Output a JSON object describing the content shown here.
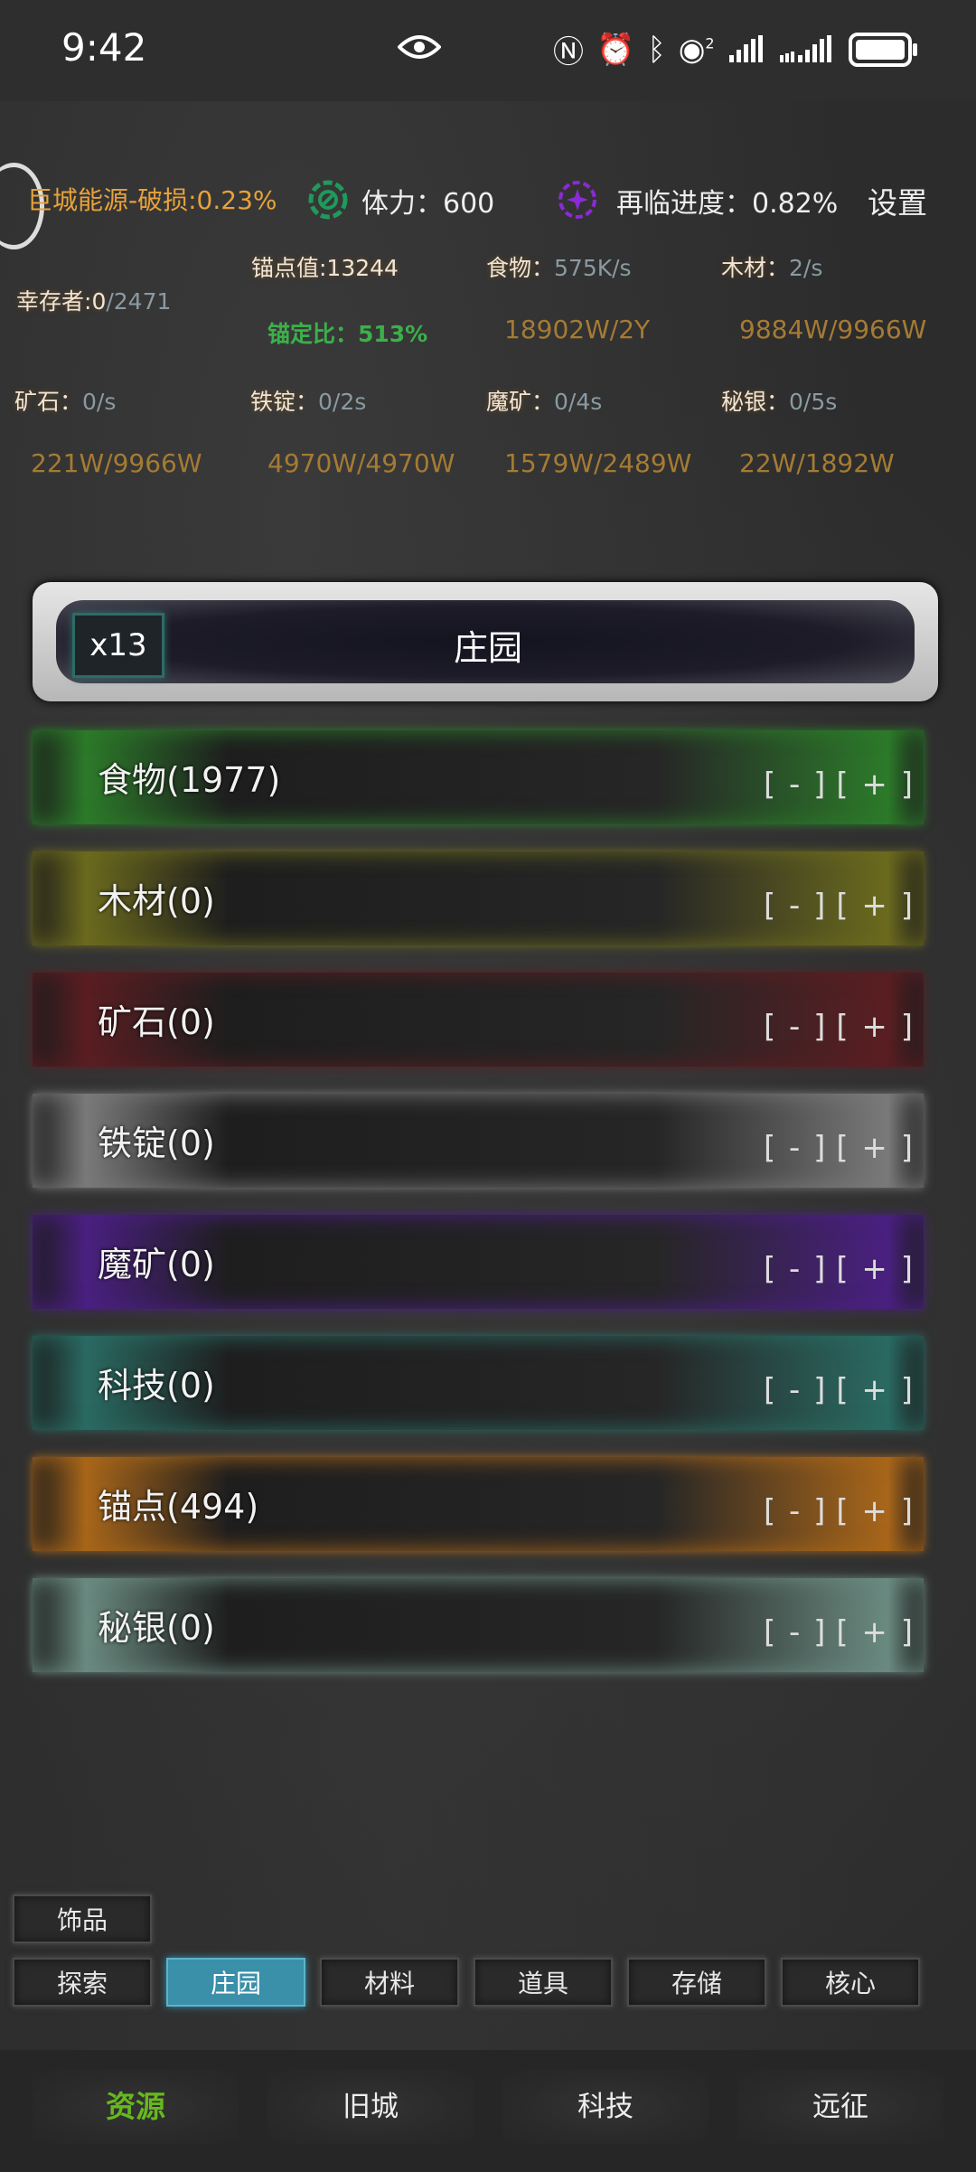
{
  "status_bar": {
    "time": "9:42",
    "icons": [
      "eye-icon",
      "nfc-icon",
      "alarm-icon",
      "bluetooth-icon",
      "hotspot-icon",
      "signal-icon",
      "signal-icon",
      "battery-icon"
    ],
    "hotspot_superscript": "2"
  },
  "header": {
    "energy": "巨城能源-破损:0.23%",
    "stamina": "体力：600",
    "recurrence": "再临进度：0.82%",
    "settings": "设置"
  },
  "stats": {
    "survivors_label": "幸存者:",
    "survivors_current": "0",
    "survivors_total": "/2471",
    "anchor_value": "锚点值:13244",
    "anchor_ratio": "锚定比：513%",
    "food_label": "食物：",
    "food_rate": "575K/s",
    "food_cap": "18902W/2Y",
    "wood_label": "木材：",
    "wood_rate": "2/s",
    "wood_cap": "9884W/9966W",
    "ore_label": "矿石：",
    "ore_rate": "0/s",
    "ore_cap": "221W/9966W",
    "ingot_label": "铁锭：",
    "ingot_rate": "0/2s",
    "ingot_cap": "4970W/4970W",
    "magic_label": "魔矿：",
    "magic_rate": "0/4s",
    "magic_cap": "1579W/2489W",
    "mithril_label": "秘银：",
    "mithril_rate": "0/5s",
    "mithril_cap": "22W/1892W"
  },
  "building": {
    "multiplier": "x13",
    "title": "庄园"
  },
  "resources": [
    {
      "name": "食物(1977)",
      "minus": "[ - ]",
      "plus": "[ + ]",
      "color": "#2c7a2a"
    },
    {
      "name": "木材(0)",
      "minus": "[ - ]",
      "plus": "[ + ]",
      "color": "#6b6a1e"
    },
    {
      "name": "矿石(0)",
      "minus": "[ - ]",
      "plus": "[ + ]",
      "color": "#5a1e22"
    },
    {
      "name": "铁锭(0)",
      "minus": "[ - ]",
      "plus": "[ + ]",
      "color": "#7a7a7a"
    },
    {
      "name": "魔矿(0)",
      "minus": "[ - ]",
      "plus": "[ + ]",
      "color": "#4a2080"
    },
    {
      "name": "科技(0)",
      "minus": "[ - ]",
      "plus": "[ + ]",
      "color": "#2a6a62"
    },
    {
      "name": "锚点(494)",
      "minus": "[ - ]",
      "plus": "[ + ]",
      "color": "#a8661a"
    },
    {
      "name": "秘银(0)",
      "minus": "[ - ]",
      "plus": "[ + ]",
      "color": "#6a8a80"
    }
  ],
  "sub_tabs": {
    "extra": "饰品",
    "items": [
      "探索",
      "庄园",
      "材料",
      "道具",
      "存储",
      "核心"
    ],
    "active": "庄园"
  },
  "bottom_nav": {
    "items": [
      "资源",
      "旧城",
      "科技",
      "远征"
    ],
    "active": "资源"
  }
}
